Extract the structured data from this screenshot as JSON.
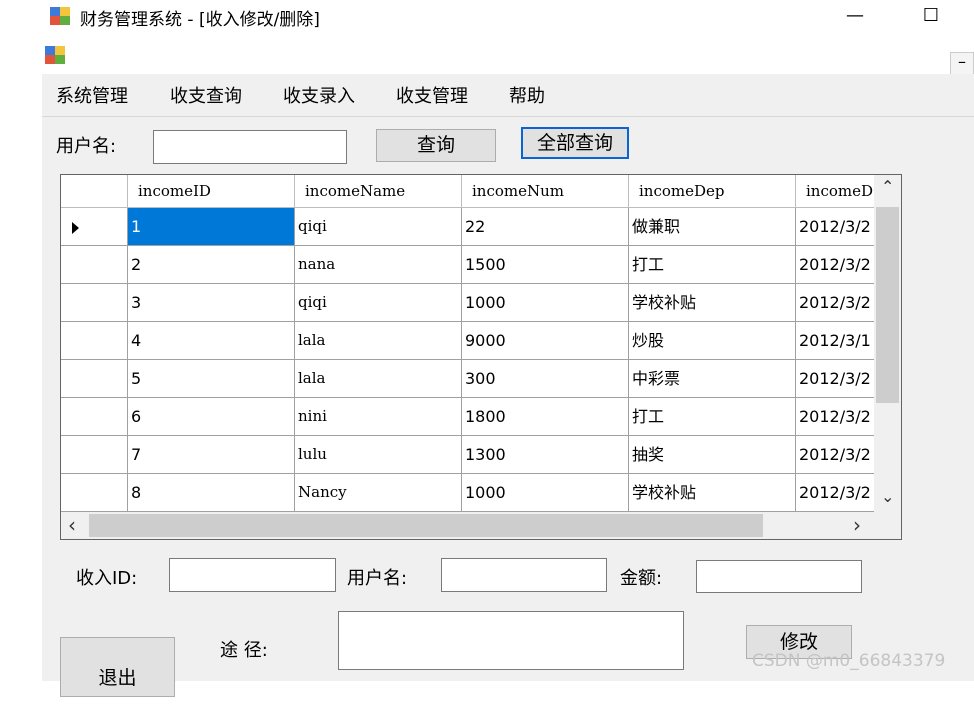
{
  "window": {
    "title": "财务管理系统 - [收入修改/删除]",
    "minimize": "—",
    "maximize": "☐"
  },
  "mdi": {
    "minimize": "–"
  },
  "menu": {
    "items": [
      "系统管理",
      "收支查询",
      "收支录入",
      "收支管理",
      "帮助"
    ]
  },
  "search": {
    "username_label": "用户名:",
    "username_value": "",
    "query_button": "查询",
    "query_all_button": "全部查询"
  },
  "grid": {
    "columns": [
      "incomeID",
      "incomeName",
      "incomeNum",
      "incomeDep",
      "incomeD"
    ],
    "rows": [
      [
        "1",
        "qiqi",
        "22",
        "做兼职",
        "2012/3/2"
      ],
      [
        "2",
        "nana",
        "1500",
        "打工",
        "2012/3/2"
      ],
      [
        "3",
        "qiqi",
        "1000",
        "学校补贴",
        "2012/3/2"
      ],
      [
        "4",
        "lala",
        "9000",
        "炒股",
        "2012/3/1"
      ],
      [
        "5",
        "lala",
        "300",
        "中彩票",
        "2012/3/2"
      ],
      [
        "6",
        "nini",
        "1800",
        "打工",
        "2012/3/2"
      ],
      [
        "7",
        "lulu",
        "1300",
        "抽奖",
        "2012/3/2"
      ],
      [
        "8",
        "Nancy",
        "1000",
        "学校补贴",
        "2012/3/2"
      ]
    ],
    "selected_row": 0,
    "scroll": {
      "up": "⌃",
      "down": "⌄",
      "left": "‹",
      "right": "›"
    }
  },
  "form": {
    "income_id_label": "收入ID:",
    "username_label": "用户名:",
    "amount_label": "金额:",
    "purpose_label": "途 径:",
    "income_id_value": "",
    "username_value": "",
    "amount_value": "",
    "purpose_value": "",
    "modify_button": "修改",
    "exit_button": "退出"
  },
  "watermark": "CSDN @m0_66843379"
}
